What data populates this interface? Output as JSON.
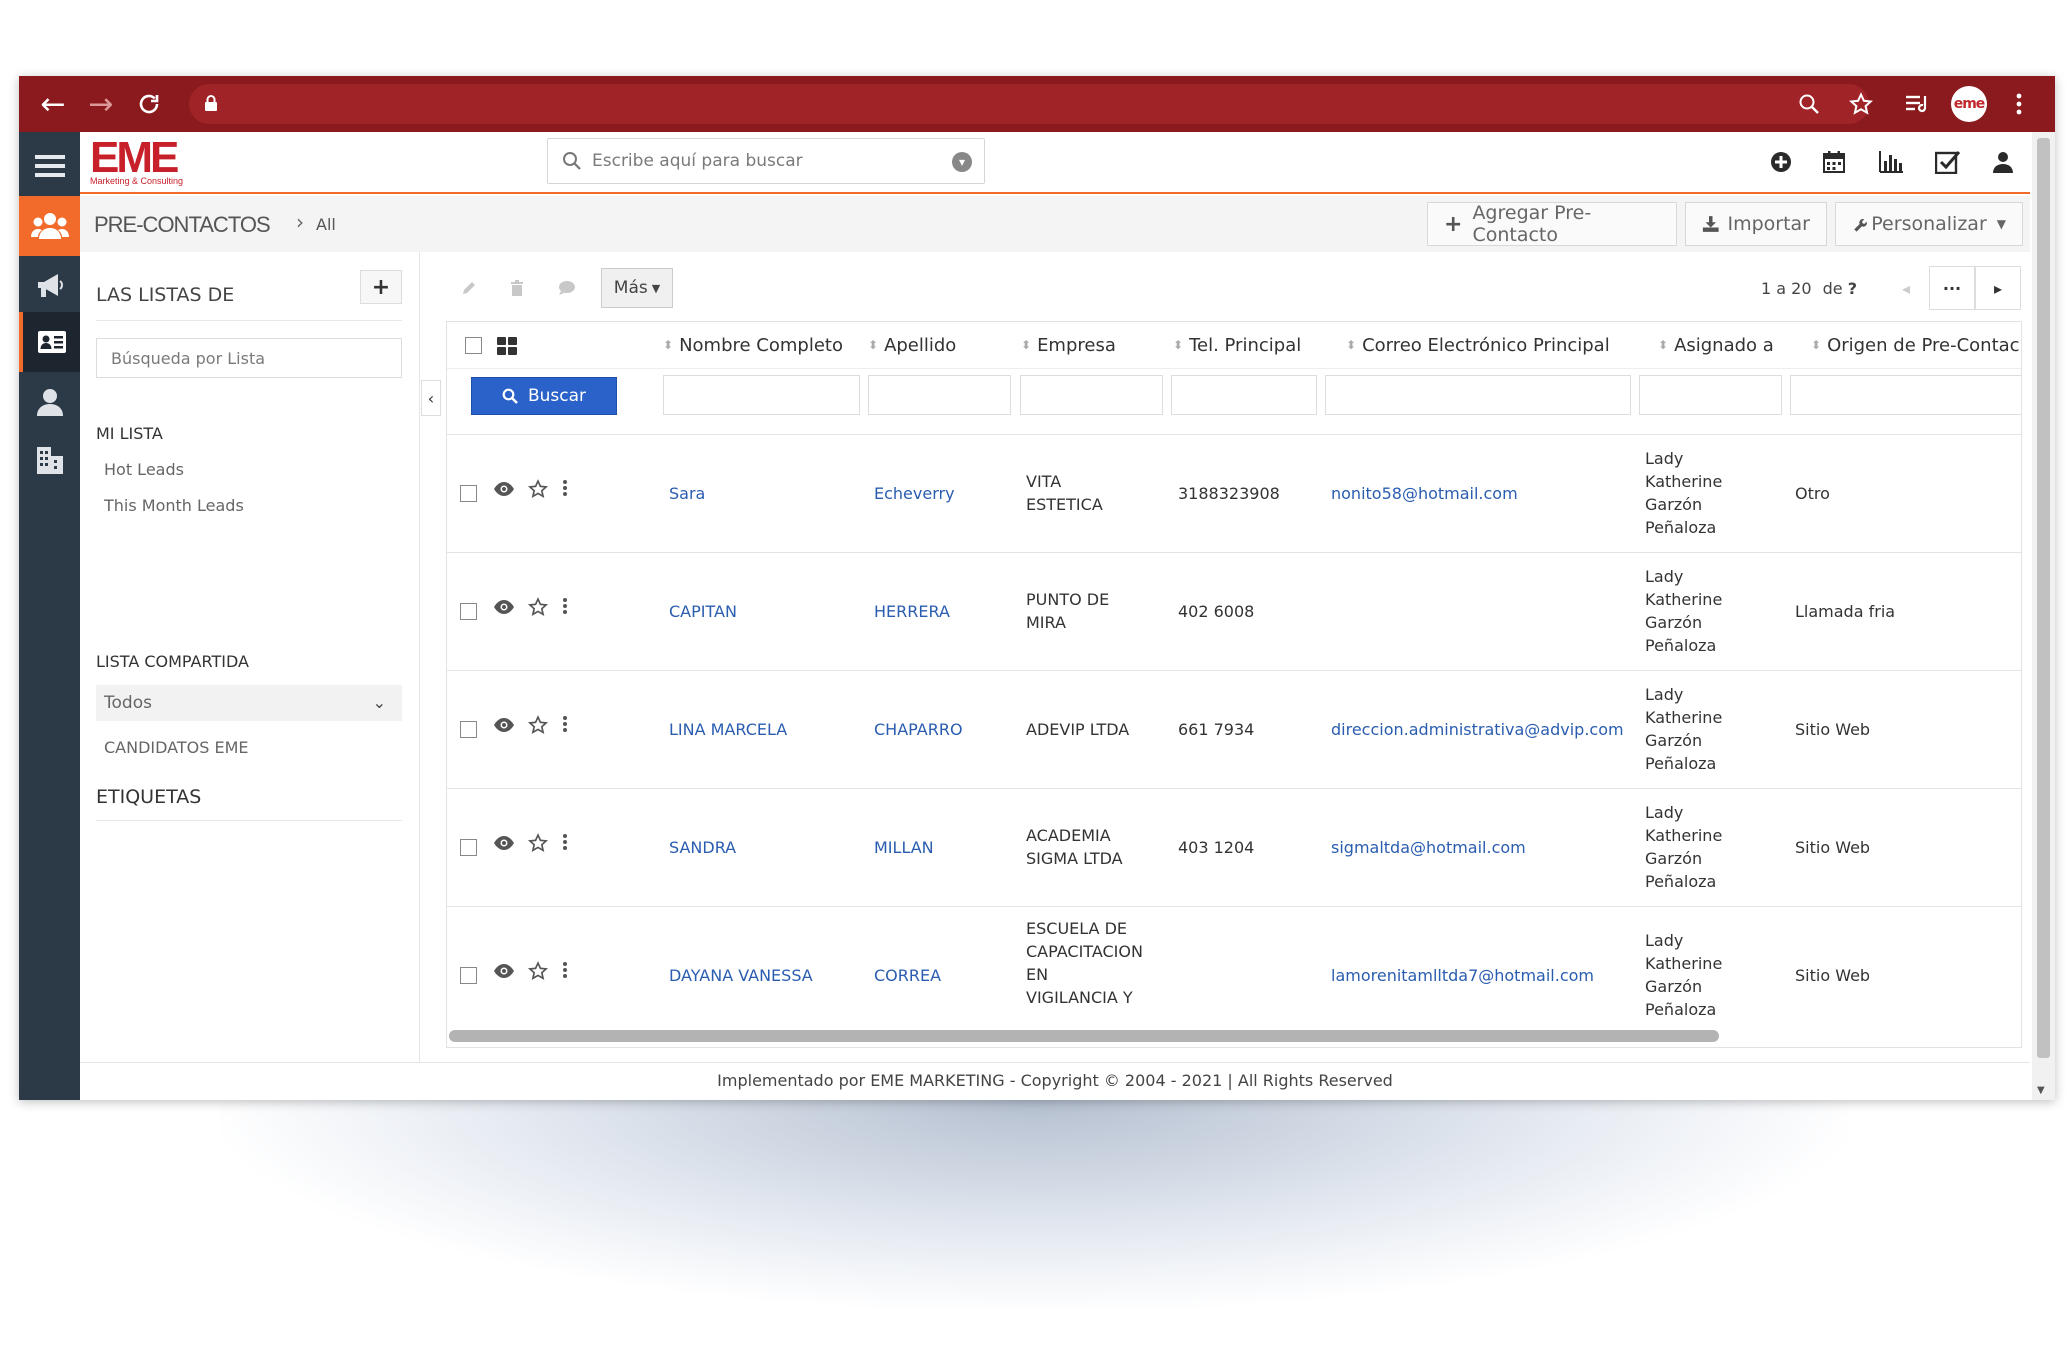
{
  "brand": {
    "logo": "EME",
    "logo_sub": "Marketing & Consulting",
    "avatar": "eme",
    "accent": "#f26b2b",
    "brand_red": "#c8202a",
    "browser_bar": "#8b1a1e",
    "nav_dark": "#2c3946"
  },
  "search": {
    "placeholder": "Escribe aquí para buscar"
  },
  "breadcrumb": {
    "module": "PRE-CONTACTOS",
    "view": "All"
  },
  "header_buttons": {
    "add": "Agregar Pre-Contacto",
    "import": "Importar",
    "customize": "Personalizar"
  },
  "sidebar": {
    "title": "LAS LISTAS DE",
    "search_placeholder": "Búsqueda por Lista",
    "my_list_heading": "MI LISTA",
    "my_lists": [
      "Hot Leads",
      "This Month Leads"
    ],
    "shared_heading": "LISTA COMPARTIDA",
    "shared_selected": "Todos",
    "shared_lists": [
      "CANDIDATOS EME"
    ],
    "tags_heading": "ETIQUETAS"
  },
  "toolbar": {
    "more": "Más",
    "pager_range": "1 a 20",
    "pager_of": "de",
    "pager_total": "?"
  },
  "table": {
    "columns": [
      "Nombre Completo",
      "Apellido",
      "Empresa",
      "Tel. Principal",
      "Correo Electrónico Principal",
      "Asignado a",
      "Origen de Pre-Contac"
    ],
    "search_button": "Buscar",
    "rows": [
      {
        "name": "Sara",
        "last": "Echeverry",
        "company": [
          "VITA",
          "ESTETICA"
        ],
        "phone": "3188323908",
        "email": "nonito58@hotmail.com",
        "assigned": [
          "Lady",
          "Katherine",
          "Garzón",
          "Peñaloza"
        ],
        "source": "Otro"
      },
      {
        "name": "CAPITAN",
        "last": "HERRERA",
        "company": [
          "PUNTO DE",
          "MIRA"
        ],
        "phone": "402 6008",
        "email": "",
        "assigned": [
          "Lady",
          "Katherine",
          "Garzón",
          "Peñaloza"
        ],
        "source": "Llamada fria"
      },
      {
        "name": "LINA MARCELA",
        "last": "CHAPARRO",
        "company": [
          "ADEVIP LTDA"
        ],
        "phone": "661 7934",
        "email": "direccion.administrativa@advip.com",
        "assigned": [
          "Lady",
          "Katherine",
          "Garzón",
          "Peñaloza"
        ],
        "source": "Sitio Web"
      },
      {
        "name": "SANDRA",
        "last": "MILLAN",
        "company": [
          "ACADEMIA",
          "SIGMA LTDA"
        ],
        "phone": "403 1204",
        "email": "sigmaltda@hotmail.com",
        "assigned": [
          "Lady",
          "Katherine",
          "Garzón",
          "Peñaloza"
        ],
        "source": "Sitio Web"
      },
      {
        "name": "DAYANA VANESSA",
        "last": "CORREA",
        "company": [
          "ESCUELA DE",
          "CAPACITACION",
          "EN",
          "VIGILANCIA Y"
        ],
        "phone": "",
        "email": "lamorenitamlltda7@hotmail.com",
        "assigned": [
          "Lady",
          "Katherine",
          "Garzón",
          "Peñaloza"
        ],
        "source": "Sitio Web"
      }
    ]
  },
  "footer": "Implementado por EME MARKETING - Copyright © 2004 - 2021 | All Rights Reserved"
}
